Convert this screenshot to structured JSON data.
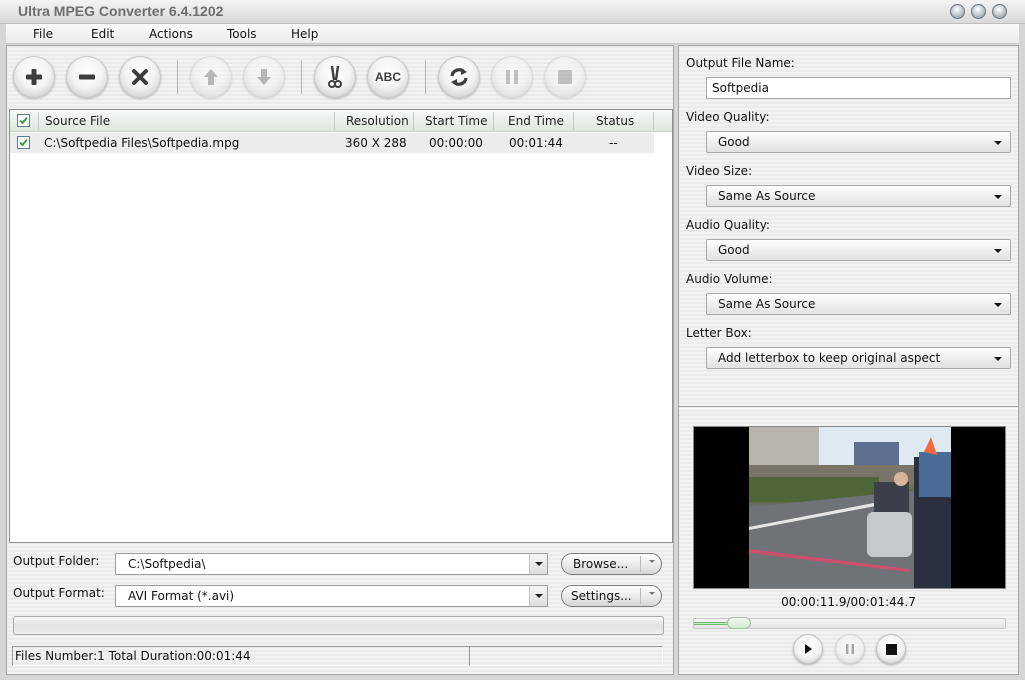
{
  "window": {
    "title": "Ultra MPEG Converter 6.4.1202",
    "controls": [
      "minimize",
      "maximize",
      "close"
    ]
  },
  "menu": {
    "items": [
      {
        "label": "File"
      },
      {
        "label": "Edit"
      },
      {
        "label": "Actions"
      },
      {
        "label": "Tools"
      },
      {
        "label": "Help"
      }
    ]
  },
  "toolbar": {
    "buttons": [
      {
        "name": "add",
        "icon": "plus-icon",
        "enabled": true
      },
      {
        "name": "remove",
        "icon": "minus-icon",
        "enabled": true
      },
      {
        "name": "clear",
        "icon": "x-icon",
        "enabled": true
      },
      {
        "name": "move-up",
        "icon": "arrow-up-icon",
        "enabled": false
      },
      {
        "name": "move-down",
        "icon": "arrow-down-icon",
        "enabled": false
      },
      {
        "name": "trim",
        "icon": "scissors-icon",
        "enabled": true
      },
      {
        "name": "rename",
        "icon": "abc-icon",
        "label": "ABC",
        "enabled": true
      },
      {
        "name": "convert",
        "icon": "refresh-icon",
        "enabled": true
      },
      {
        "name": "pause",
        "icon": "pause-icon",
        "enabled": false
      },
      {
        "name": "stop",
        "icon": "stop-icon",
        "enabled": false
      }
    ]
  },
  "file_list": {
    "header_checked": true,
    "columns": [
      "Source File",
      "Resolution",
      "Start Time",
      "End Time",
      "Status"
    ],
    "rows": [
      {
        "checked": true,
        "source_file": "C:\\Softpedia Files\\Softpedia.mpg",
        "resolution": "360 X 288",
        "start_time": "00:00:00",
        "end_time": "00:01:44",
        "status": "--"
      }
    ]
  },
  "output": {
    "folder_label": "Output Folder:",
    "folder_value": "C:\\Softpedia\\",
    "browse_label": "Browse...",
    "format_label": "Output Format:",
    "format_value": "AVI Format (*.avi)",
    "settings_label": "Settings...",
    "progress": 0
  },
  "statusbar": {
    "text": "Files Number:1  Total Duration:00:01:44",
    "secondary": ""
  },
  "settings": {
    "output_file_name_label": "Output File Name:",
    "output_file_name": "Softpedia",
    "video_quality_label": "Video Quality:",
    "video_quality": "Good",
    "video_size_label": "Video Size:",
    "video_size": "Same As Source",
    "audio_quality_label": "Audio Quality:",
    "audio_quality": "Good",
    "audio_volume_label": "Audio Volume:",
    "audio_volume": "Same As Source",
    "letter_box_label": "Letter Box:",
    "letter_box": "Add letterbox to keep original aspect"
  },
  "preview": {
    "time_readout": "00:00:11.9/00:01:44.7",
    "position_seconds": 11.9,
    "duration_seconds": 104.7,
    "buttons": [
      {
        "name": "play",
        "icon": "play-icon",
        "enabled": true
      },
      {
        "name": "pause",
        "icon": "pause-icon",
        "enabled": false
      },
      {
        "name": "stop",
        "icon": "stop-icon",
        "enabled": true
      }
    ]
  },
  "colors": {
    "seek_fill": "#6dbb6d",
    "checkmark": "#2f9a2f",
    "list_header": "#dde6dd"
  }
}
